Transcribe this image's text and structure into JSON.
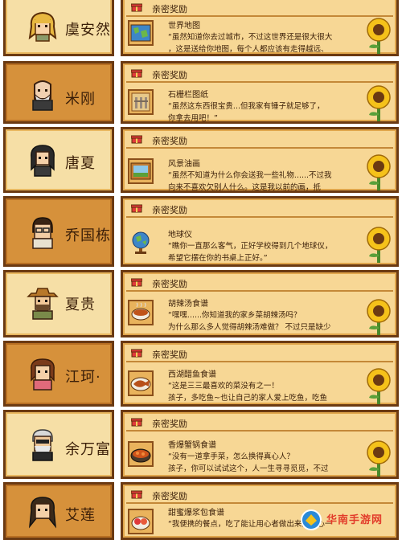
{
  "reward_header": "亲密奖励",
  "rows": [
    {
      "character": "虞安然",
      "item": "世界地图",
      "icon": "world-map-icon",
      "line1": "“虽然知道你去过城市，不过这世界还是很大很大",
      "line2": "，这是送给你地图，每个人都应该有走得越远、"
    },
    {
      "character": "米刚",
      "item": "石栅栏图纸",
      "icon": "stone-fence-blueprint-icon",
      "line1": "“虽然这东西很宝贵...但我家有锤子就足够了，",
      "line2": "你拿去用吧！”"
    },
    {
      "character": "唐夏",
      "item": "风景油画",
      "icon": "landscape-painting-icon",
      "line1": "“虽然不知道为什么你会送我一些礼物......不过我",
      "line2": "向来不喜欢欠别人什么。这是我以前的画，抵"
    },
    {
      "character": "乔国栋",
      "item": "地球仪",
      "icon": "globe-icon",
      "line1": "“瞧你一直那么客气，正好学校得到几个地球仪，",
      "line2": "希望它摆在你的书桌上正好。”"
    },
    {
      "character": "夏贵",
      "item": "胡辣汤食谱",
      "icon": "hot-soup-icon",
      "line1": "“嘿嘿......你知道我的家乡菜胡辣汤吗？",
      "line2": "为什么那么多人觉得胡辣汤难做？ 不过只是缺少"
    },
    {
      "character": "江珂·",
      "item": "西湖醋鱼食谱",
      "icon": "vinegar-fish-icon",
      "line1": "“这是三三最喜欢的菜没有之一！",
      "line2": "孩子，多吃鱼~也让自己的家人爱上吃鱼，吃鱼"
    },
    {
      "character": "余万富",
      "item": "香爆蟹锅食谱",
      "icon": "crab-pot-icon",
      "line1": "“没有一道拿手菜，怎么换得真心人？",
      "line2": "孩子，你可以试试这个，人一生寻寻觅觅，不过"
    },
    {
      "character": "艾莲",
      "item": "甜蜜爆浆包食谱",
      "icon": "sweet-bun-icon",
      "line1": "“我便携的餐点，吃了能让用心者做出来的会心一",
      "line2": ""
    }
  ],
  "watermark": "华南手游网",
  "colors": {
    "border": "#6b3a12",
    "tile_light": "#f6dfa6",
    "tile_dark": "#d6913b",
    "panel": "#f7d795",
    "text": "#3a1e08"
  }
}
